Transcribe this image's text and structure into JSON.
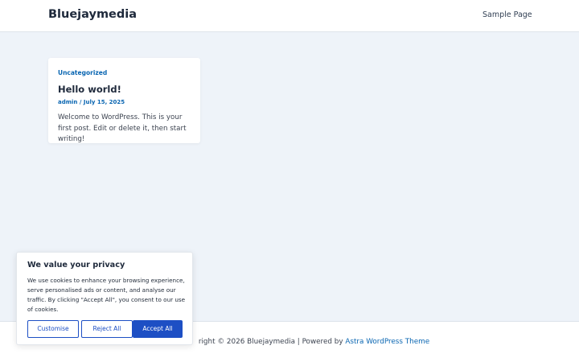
{
  "header": {
    "site_title": "Bluejaymedia",
    "nav_item": "Sample Page"
  },
  "post": {
    "category": "Uncategorized",
    "title": "Hello world!",
    "author": "admin",
    "separator": " / ",
    "date": "July 15, 2025",
    "excerpt": "Welcome to WordPress. This is your first post. Edit or delete it, then start writing!"
  },
  "footer": {
    "text_prefix": "right © 2026 Bluejaymedia | Powered by ",
    "theme_link": "Astra WordPress Theme"
  },
  "cookie_banner": {
    "title": "We value your privacy",
    "body": "We use cookies to enhance your browsing experience, serve personalised ads or content, and analyse our traffic. By clicking \"Accept All\", you consent to our use of cookies.",
    "customise_label": "Customise",
    "reject_label": "Reject All",
    "accept_label": "Accept All"
  },
  "colors": {
    "accent": "#0a66b2",
    "button_blue": "#1d4fc4",
    "page_background": "#eef3f9"
  }
}
